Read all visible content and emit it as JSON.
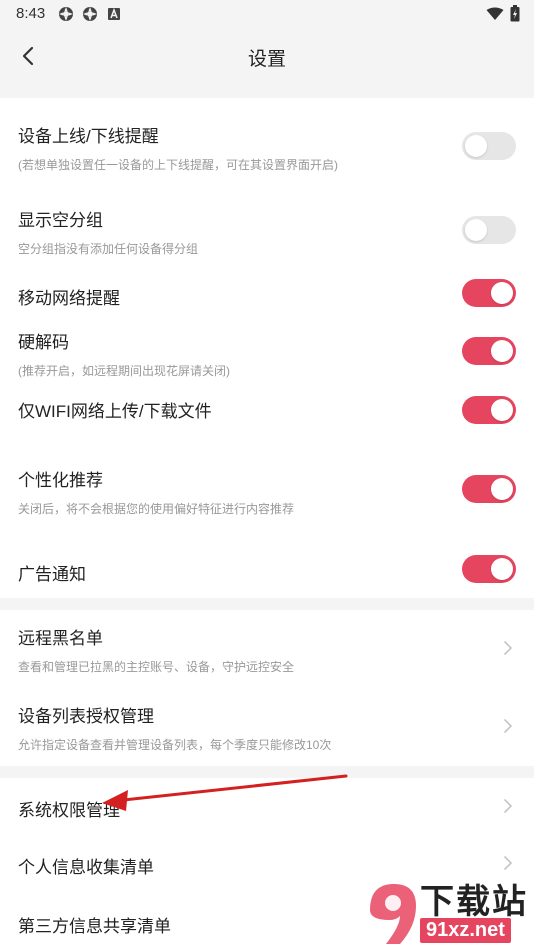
{
  "status_bar": {
    "time": "8:43",
    "left_icons": [
      "gear-icon",
      "gear-icon",
      "app-a-icon"
    ],
    "right_icons": [
      "wifi-icon",
      "battery-icon"
    ]
  },
  "header": {
    "title": "设置",
    "back_icon": "back-arrow-icon"
  },
  "colors": {
    "accent": "#e64560",
    "toggle_off": "#e6e6e6",
    "background": "#f4f4f4",
    "card": "#ffffff",
    "subtext": "#999999",
    "annotation_arrow": "#d42020"
  },
  "toggles": [
    {
      "title": "设备上线/下线提醒",
      "subtitle": "(若想单独设置任一设备的上下线提醒，可在其设置界面开启)",
      "on": false
    },
    {
      "title": "显示空分组",
      "subtitle": "空分组指没有添加任何设备得分组",
      "on": false
    },
    {
      "title": "移动网络提醒",
      "subtitle": "",
      "on": true
    },
    {
      "title": "硬解码",
      "subtitle": "(推荐开启，如远程期间出现花屏请关闭)",
      "on": true
    },
    {
      "title": "仅WIFI网络上传/下载文件",
      "subtitle": "",
      "on": true
    },
    {
      "title": "个性化推荐",
      "subtitle": "关闭后，将不会根据您的使用偏好特征进行内容推荐",
      "on": true
    },
    {
      "title": "广告通知",
      "subtitle": "",
      "on": true
    }
  ],
  "management": [
    {
      "title": "远程黑名单",
      "subtitle": "查看和管理已拉黑的主控账号、设备，守护远控安全"
    },
    {
      "title": "设备列表授权管理",
      "subtitle": "允许指定设备查看并管理设备列表，每个季度只能修改10次"
    }
  ],
  "privacy": [
    {
      "title": "系统权限管理"
    },
    {
      "title": "个人信息收集清单"
    },
    {
      "title": "第三方信息共享清单"
    }
  ],
  "watermark": {
    "brand": "下载站",
    "domain": "91xz.net"
  }
}
